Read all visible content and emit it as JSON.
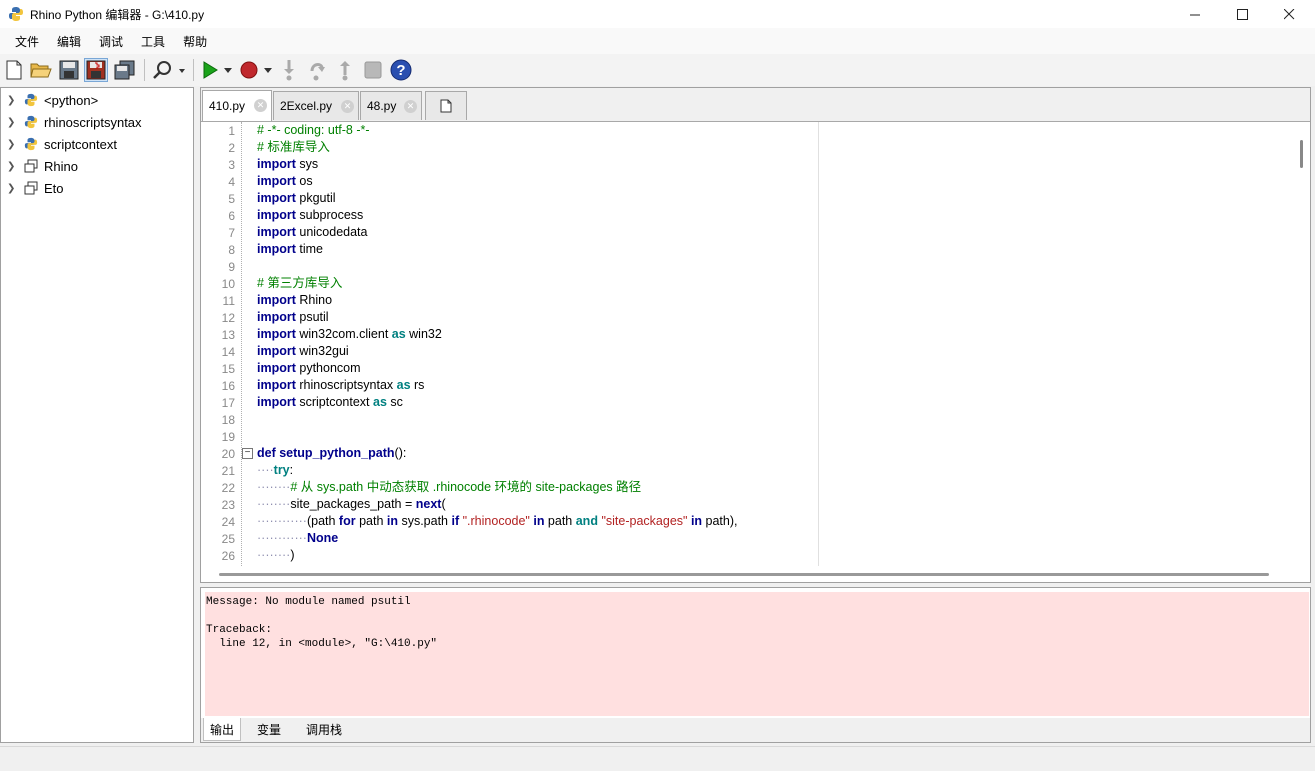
{
  "window": {
    "title": "Rhino Python 编辑器 - G:\\410.py"
  },
  "menu": [
    "文件",
    "编辑",
    "调试",
    "工具",
    "帮助"
  ],
  "toolbar": {
    "icons": [
      "new-file-icon",
      "open-folder-icon",
      "save-icon",
      "save-as-icon",
      "save-all-icon",
      "find-icon",
      "run-icon",
      "run-dropdown-icon",
      "record-icon",
      "record-dropdown-icon",
      "step-into-icon",
      "step-over-icon",
      "step-out-icon",
      "stop-icon",
      "help-icon"
    ]
  },
  "sidebar": {
    "items": [
      {
        "label": "<python>",
        "icon": "python-icon"
      },
      {
        "label": "rhinoscriptsyntax",
        "icon": "python-icon"
      },
      {
        "label": "scriptcontext",
        "icon": "python-icon"
      },
      {
        "label": "Rhino",
        "icon": "namespace-icon"
      },
      {
        "label": "Eto",
        "icon": "namespace-icon"
      }
    ]
  },
  "tabs": [
    {
      "label": "410.py",
      "active": true
    },
    {
      "label": "2Excel.py",
      "active": false
    },
    {
      "label": "48.py",
      "active": false
    }
  ],
  "code": {
    "lines": [
      "# -*- coding: utf-8 -*-",
      "# 标准库导入",
      "import sys",
      "import os",
      "import pkgutil",
      "import subprocess",
      "import unicodedata",
      "import time",
      "",
      "# 第三方库导入",
      "import Rhino",
      "import psutil",
      "import win32com.client as win32",
      "import win32gui",
      "import pythoncom",
      "import rhinoscriptsyntax as rs",
      "import scriptcontext as sc",
      "",
      "",
      "def setup_python_path():",
      "try:",
      "# 从 sys.path 中动态获取 .rhinocode 环境的 site-packages 路径",
      "site_packages_path = next(",
      "(path for path in sys.path if \".rhinocode\" in path and \"site-packages\" in path),",
      "None",
      ")"
    ],
    "line_numbers": [
      "1",
      "2",
      "3",
      "4",
      "5",
      "6",
      "7",
      "8",
      "9",
      "10",
      "11",
      "12",
      "13",
      "14",
      "15",
      "16",
      "17",
      "18",
      "19",
      "20",
      "21",
      "22",
      "23",
      "24",
      "25",
      "26"
    ]
  },
  "output": {
    "text": "Message: No module named psutil\n\nTraceback:\n  line 12, in <module>, \"G:\\410.py\""
  },
  "output_tabs": [
    "输出",
    "变量",
    "调用栈"
  ]
}
